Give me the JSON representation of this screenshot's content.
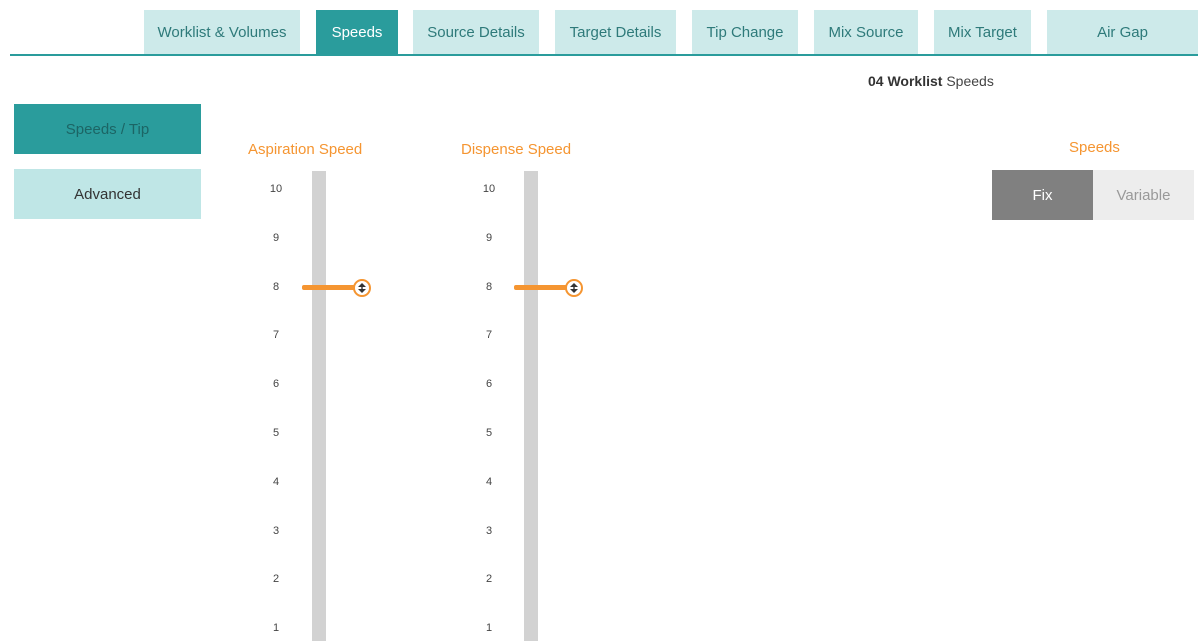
{
  "tabs": [
    {
      "label": "Worklist & Volumes",
      "active": false
    },
    {
      "label": "Speeds",
      "active": true
    },
    {
      "label": "Source Details",
      "active": false
    },
    {
      "label": "Target Details",
      "active": false
    },
    {
      "label": "Tip Change",
      "active": false
    },
    {
      "label": "Mix Source",
      "active": false
    },
    {
      "label": "Mix Target",
      "active": false
    },
    {
      "label": "Air Gap",
      "active": false
    }
  ],
  "page_title": {
    "number": "04",
    "bold": "Worklist",
    "rest": "Speeds"
  },
  "sidebar": {
    "items": [
      {
        "label": "Speeds / Tip",
        "active": true
      },
      {
        "label": "Advanced",
        "active": false
      }
    ]
  },
  "sliders": {
    "ticks": [
      "10",
      "9",
      "8",
      "7",
      "6",
      "5",
      "4",
      "3",
      "2",
      "1"
    ],
    "aspiration": {
      "title": "Aspiration Speed",
      "value": 8
    },
    "dispense": {
      "title": "Dispense Speed",
      "value": 8
    }
  },
  "speeds_mode": {
    "label": "Speeds",
    "options": [
      "Fix",
      "Variable"
    ],
    "selected": "Fix"
  },
  "colors": {
    "accent": "#2a9c9c",
    "tab_inactive": "#cdeaea",
    "slider": "#f59531",
    "track": "#d2d2d2",
    "fix_selected": "#808080"
  },
  "icons": {
    "slider_knob": "up-down-arrows-icon"
  }
}
